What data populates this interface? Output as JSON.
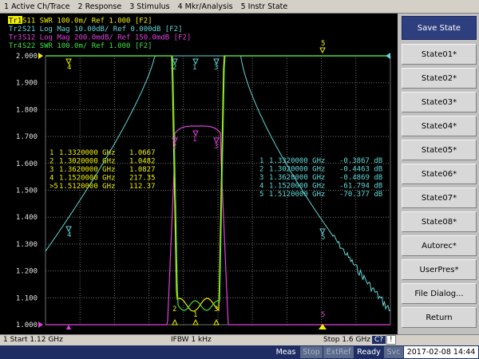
{
  "menu": [
    "1 Active Ch/Trace",
    "2 Response",
    "3 Stimulus",
    "4 Mkr/Analysis",
    "5 Instr State"
  ],
  "traces": [
    {
      "id": "Tr1",
      "label": "Tr1",
      "rest": " S11  SWR 100.0m/ Ref 1.000 [F2]",
      "color": "#f0f000"
    },
    {
      "id": "Tr2",
      "label": "Tr2",
      "rest": " S21  Log Mag 10.00dB/ Ref 0.000dB [F2]",
      "color": "#60d8d8"
    },
    {
      "id": "Tr3",
      "label": "Tr3",
      "rest": " S12  Log Mag 200.0mdB/ Ref 150.0mdB [F2]",
      "color": "#e040e0"
    },
    {
      "id": "Tr4",
      "label": "Tr4",
      "rest": " S22  SWR 100.0m/ Ref 1.000 [F2]",
      "color": "#40e040"
    }
  ],
  "colors": {
    "tr1": "#f0f000",
    "tr2": "#60d8d8",
    "tr3": "#e040e0",
    "tr4": "#40e040",
    "grid": "#707070"
  },
  "y_ticks": [
    "2.000",
    "1.900",
    "1.800",
    "1.700",
    "1.600",
    "1.500",
    "1.400",
    "1.300",
    "1.200",
    "1.100",
    "1.000"
  ],
  "marker_table_left": [
    {
      "num": "1",
      "freq": "1.3320000 GHz",
      "value": "1.0667"
    },
    {
      "num": "2",
      "freq": "1.3020000 GHz",
      "value": "1.0482"
    },
    {
      "num": "3",
      "freq": "1.3620000 GHz",
      "value": "1.0827"
    },
    {
      "num": "4",
      "freq": "1.1520000 GHz",
      "value": "217.35"
    },
    {
      "num": ">5",
      "freq": "1.5120000 GHz",
      "value": "112.37"
    }
  ],
  "marker_table_right": [
    {
      "num": "1",
      "freq": "1.3320000 GHz",
      "value": "-0.3867 dB"
    },
    {
      "num": "2",
      "freq": "1.3020000 GHz",
      "value": "-0.4463 dB"
    },
    {
      "num": "3",
      "freq": "1.3620000 GHz",
      "value": "-0.4869 dB"
    },
    {
      "num": "4",
      "freq": "1.1520000 GHz",
      "value": "-61.794 dB"
    },
    {
      "num": "5",
      "freq": "1.5120000 GHz",
      "value": "-70.377 dB"
    }
  ],
  "softkeys": {
    "title": "Save State",
    "items": [
      "State01*",
      "State02*",
      "State03*",
      "State04*",
      "State05*",
      "State06*",
      "State07*",
      "State08*",
      "Autorec*",
      "UserPres*",
      "File Dialog...",
      "Return"
    ]
  },
  "status": {
    "start": "1  Start 1.12 GHz",
    "ifbw": "IFBW 1 kHz",
    "stop": "Stop 1.6 GHz",
    "c": "C?",
    "nav": "!"
  },
  "bottom": {
    "meas": "Meas",
    "stop": "Stop",
    "extref": "ExtRef",
    "ready": "Ready",
    "svc": "Svc",
    "datetime": "2017-02-08 14:44"
  },
  "markers": {
    "m1": "1",
    "m2": "2",
    "m3": "3",
    "m4": "4",
    "m5": "5"
  }
}
